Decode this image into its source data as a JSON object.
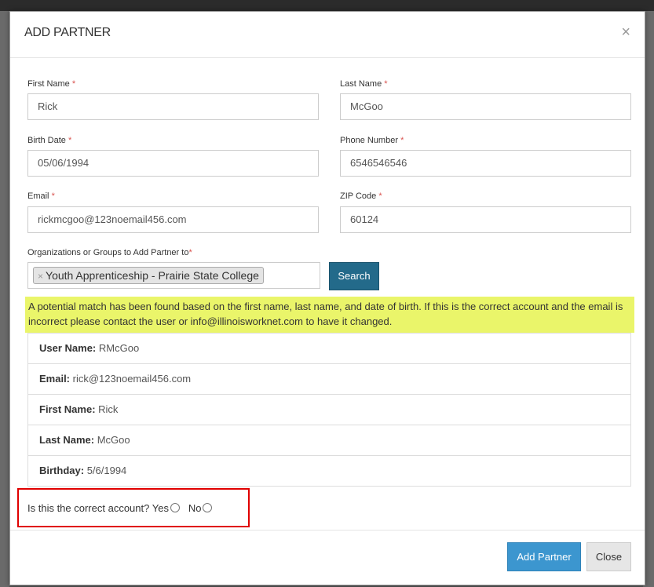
{
  "modal": {
    "title": "ADD PARTNER",
    "close_icon": "close-icon"
  },
  "form": {
    "first_name": {
      "label": "First Name",
      "value": "Rick"
    },
    "last_name": {
      "label": "Last Name",
      "value": "McGoo"
    },
    "birth_date": {
      "label": "Birth Date",
      "value": "05/06/1994"
    },
    "phone_number": {
      "label": "Phone Number",
      "value": "6546546546"
    },
    "email": {
      "label": "Email",
      "value": "rickmcgoo@123noemail456.com"
    },
    "zip_code": {
      "label": "ZIP Code",
      "value": "60124"
    },
    "organizations": {
      "label": "Organizations or Groups to Add Partner to",
      "selected_tag": "Youth Apprenticeship - Prairie State College",
      "tag_remove": "×"
    },
    "required_marker": "*",
    "search_button": "Search"
  },
  "alert": {
    "text": "A potential match has been found based on the first name, last name, and date of birth. If this is the correct account and the email is incorrect please contact the user or info@illinoisworknet.com to have it changed."
  },
  "match": [
    {
      "label": "User Name:",
      "value": "RMcGoo"
    },
    {
      "label": "Email:",
      "value": "rick@123noemail456.com"
    },
    {
      "label": "First Name:",
      "value": "Rick"
    },
    {
      "label": "Last Name:",
      "value": "McGoo"
    },
    {
      "label": "Birthday:",
      "value": "5/6/1994"
    }
  ],
  "confirm": {
    "question": "Is this the correct account?",
    "yes": "Yes",
    "no": "No"
  },
  "footer": {
    "add_partner": "Add Partner",
    "close": "Close"
  },
  "colors": {
    "primary": "#3c96cf",
    "search": "#236a8a",
    "alert_bg": "#eaf56a",
    "highlight_border": "#e00000",
    "required": "#d9534f"
  }
}
